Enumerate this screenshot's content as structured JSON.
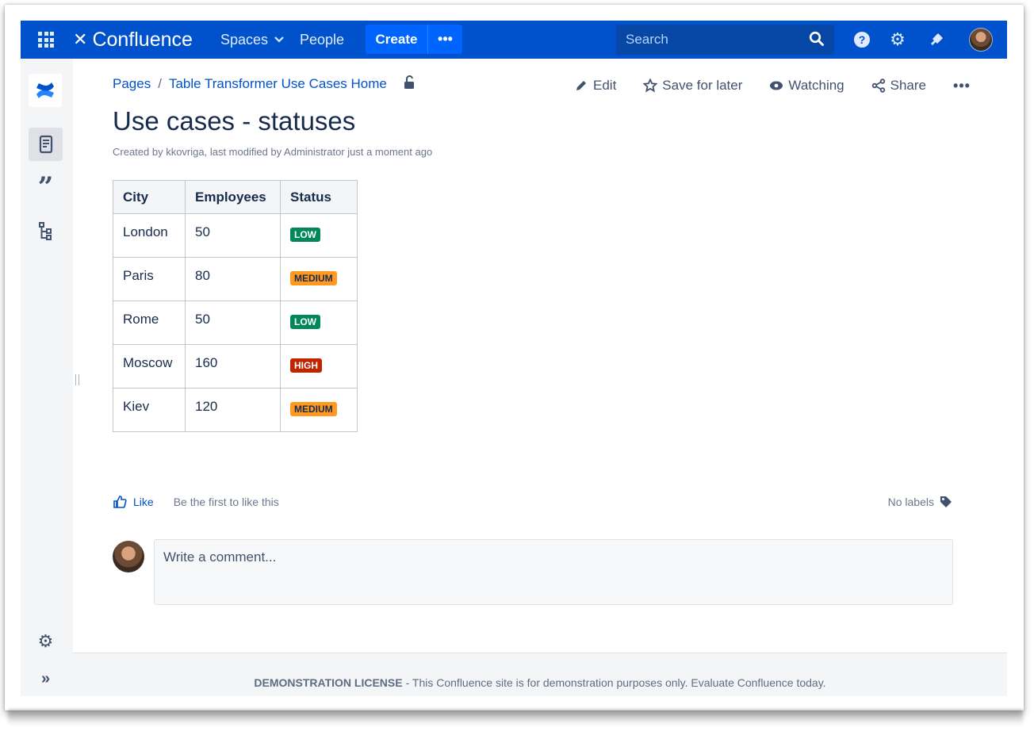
{
  "topbar": {
    "logo_text": "Confluence",
    "nav_spaces": "Spaces",
    "nav_people": "People",
    "create_label": "Create",
    "more_label": "•••",
    "search_placeholder": "Search",
    "help_label": "?"
  },
  "breadcrumb": {
    "pages": "Pages",
    "separator": "/",
    "parent": "Table Transformer Use Cases Home"
  },
  "actions": {
    "edit": "Edit",
    "save": "Save for later",
    "watching": "Watching",
    "share": "Share",
    "more": "•••"
  },
  "page": {
    "title": "Use cases - statuses",
    "byline": "Created by kkovriga, last modified by Administrator just a moment ago"
  },
  "table": {
    "headers": [
      "City",
      "Employees",
      "Status"
    ],
    "rows": [
      {
        "city": "London",
        "employees": "50",
        "status": "LOW",
        "level": "low"
      },
      {
        "city": "Paris",
        "employees": "80",
        "status": "MEDIUM",
        "level": "medium"
      },
      {
        "city": "Rome",
        "employees": "50",
        "status": "LOW",
        "level": "low"
      },
      {
        "city": "Moscow",
        "employees": "160",
        "status": "HIGH",
        "level": "high"
      },
      {
        "city": "Kiev",
        "employees": "120",
        "status": "MEDIUM",
        "level": "medium"
      }
    ]
  },
  "social": {
    "like": "Like",
    "like_text": "Be the first to like this",
    "labels": "No labels"
  },
  "comment": {
    "placeholder": "Write a comment..."
  },
  "footer": {
    "license": "DEMONSTRATION LICENSE",
    "text": "- This Confluence site is for demonstration purposes only. Evaluate Confluence today."
  },
  "colors": {
    "topbar": "#0052cc",
    "create": "#0065ff",
    "low": "#00875a",
    "medium": "#ff991f",
    "high": "#bf2600"
  },
  "icons": [
    "app-switcher-icon",
    "confluence-logo-icon",
    "chevron-down-icon",
    "search-icon",
    "help-icon",
    "settings-icon",
    "notifications-icon",
    "pages-icon",
    "quote-icon",
    "tree-icon",
    "unlock-icon",
    "pencil-icon",
    "star-icon",
    "eye-icon",
    "share-icon",
    "like-icon",
    "tag-icon",
    "expand-icon"
  ]
}
